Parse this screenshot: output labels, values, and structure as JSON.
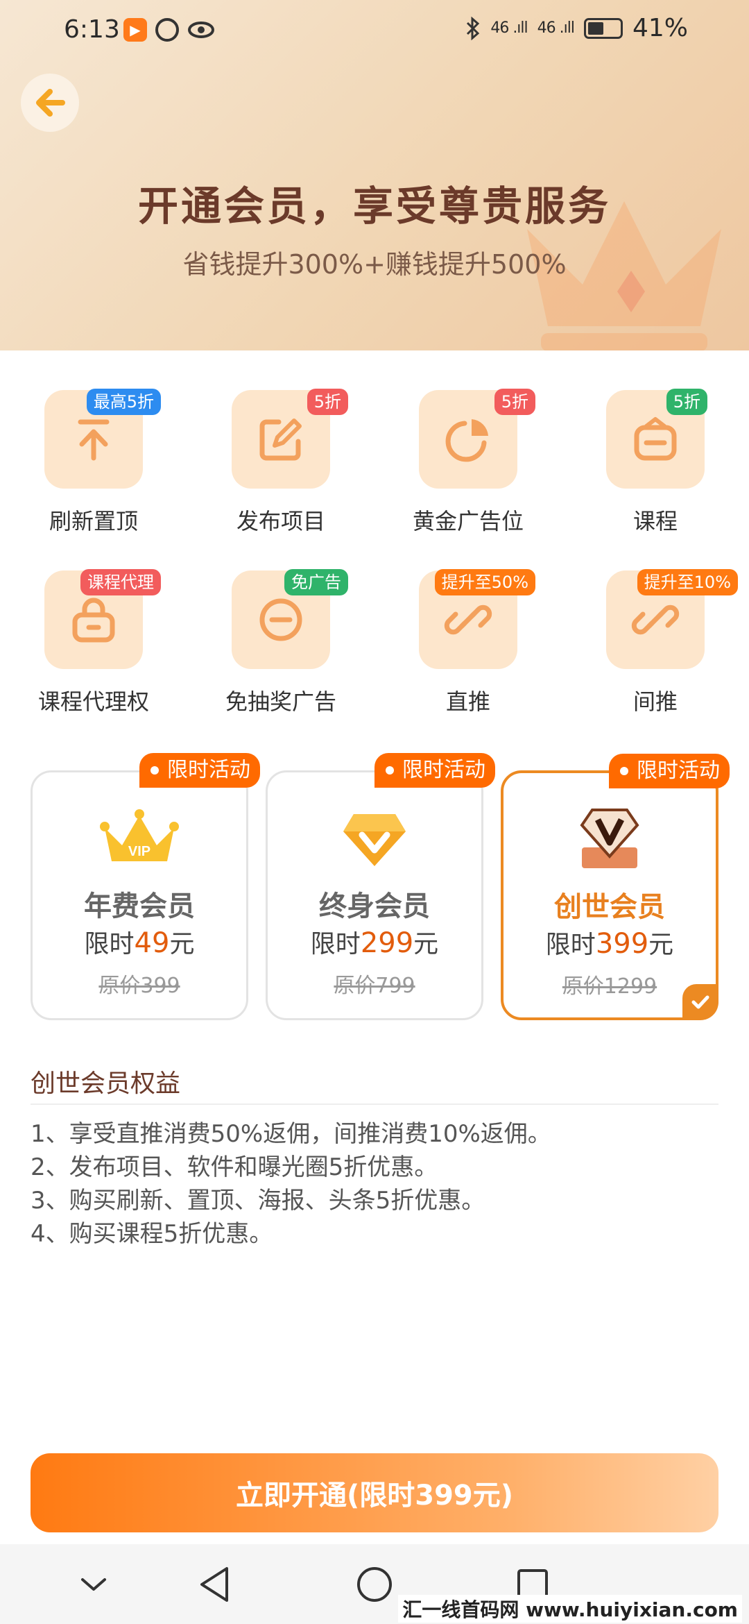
{
  "status_bar": {
    "time": "6:13",
    "battery": "41%",
    "signal1": "46 .ıll",
    "signal2": "46 .ıll"
  },
  "header": {
    "title": "开通会员，享受尊贵服务",
    "subtitle": "省钱提升300%+赚钱提升500%"
  },
  "benefits": [
    {
      "label": "刷新置顶",
      "badge": "最高5折",
      "badge_color": "#2d8cf0",
      "icon": "refresh-top-icon"
    },
    {
      "label": "发布项目",
      "badge": "5折",
      "badge_color": "#f25c5c",
      "icon": "edit-icon"
    },
    {
      "label": "黄金广告位",
      "badge": "5折",
      "badge_color": "#f25c5c",
      "icon": "pie-chart-icon"
    },
    {
      "label": "课程",
      "badge": "5折",
      "badge_color": "#2fb36a",
      "icon": "course-icon"
    },
    {
      "label": "课程代理权",
      "badge": "课程代理",
      "badge_color": "#f25c5c",
      "icon": "lock-icon"
    },
    {
      "label": "免抽奖广告",
      "badge": "免广告",
      "badge_color": "#2fb36a",
      "icon": "minus-circle-icon"
    },
    {
      "label": "直推",
      "badge": "提升至50%",
      "badge_color": "#ff7a12",
      "icon": "link-icon"
    },
    {
      "label": "间推",
      "badge": "提升至10%",
      "badge_color": "#ff7a12",
      "icon": "link-icon"
    }
  ],
  "plans": [
    {
      "name": "年费会员",
      "price_prefix": "限时",
      "price": "49",
      "price_suffix": "元",
      "original": "原价399",
      "tag": "限时活动",
      "icon": "vip-crown-icon",
      "selected": false
    },
    {
      "name": "终身会员",
      "price_prefix": "限时",
      "price": "299",
      "price_suffix": "元",
      "original": "原价799",
      "tag": "限时活动",
      "icon": "diamond-icon",
      "selected": false
    },
    {
      "name": "创世会员",
      "price_prefix": "限时",
      "price": "399",
      "price_suffix": "元",
      "original": "原价1299",
      "tag": "限时活动",
      "icon": "v-badge-icon",
      "selected": true
    }
  ],
  "rights": {
    "title": "创世会员权益",
    "items": [
      "1、享受直推消费50%返佣，间推消费10%返佣。",
      "2、发布项目、软件和曝光圈5折优惠。",
      "3、购买刷新、置顶、海报、头条5折优惠。",
      "4、购买课程5折优惠。"
    ]
  },
  "cta": {
    "label": "立即开通(限时399元)"
  },
  "watermark": "汇一线首码网 www.huiyixian.com",
  "colors": {
    "accent": "#ff7a12",
    "brand_brown": "#6b3a2a",
    "tile_bg": "#fde6cc"
  }
}
